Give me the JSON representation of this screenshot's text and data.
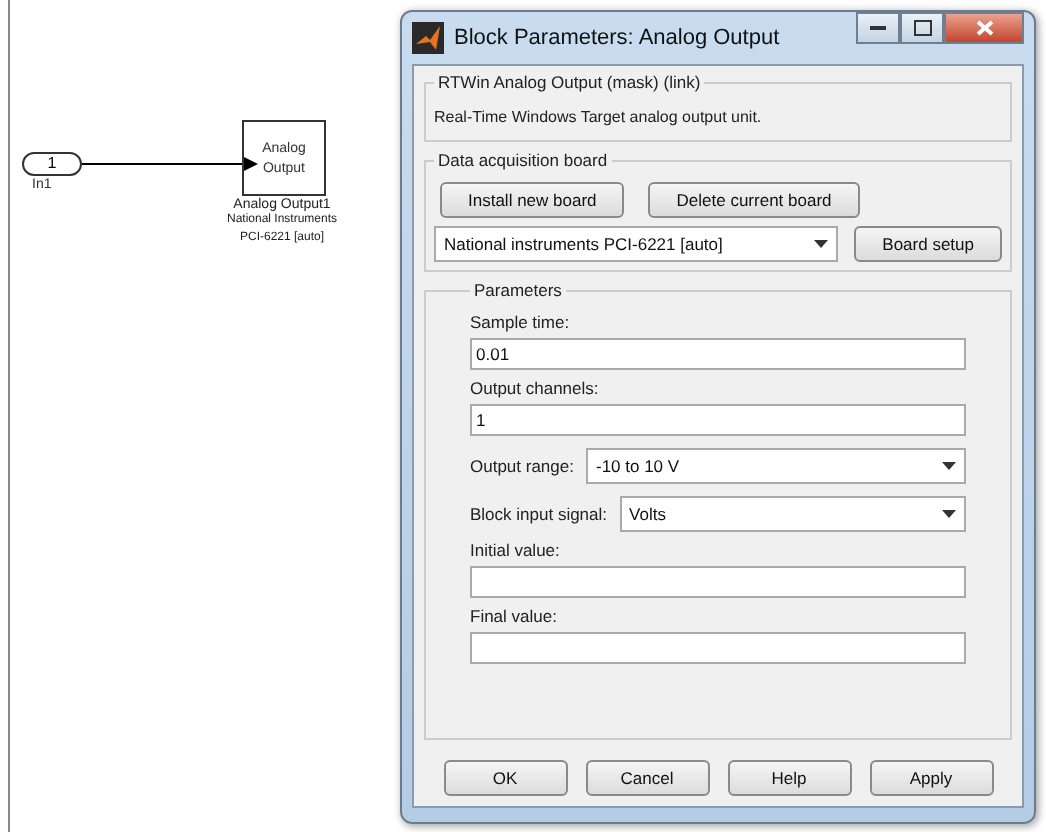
{
  "model": {
    "inport": {
      "number": "1",
      "label": "In1"
    },
    "block": {
      "lines": [
        "Analog",
        "Output"
      ],
      "name": "Analog Output1",
      "sublabels": [
        "National Instruments",
        "PCI-6221 [auto]"
      ]
    }
  },
  "dialog": {
    "title": "Block Parameters: Analog Output",
    "mask": {
      "legend": "RTWin Analog Output (mask) (link)",
      "description": "Real-Time Windows Target analog output unit."
    },
    "board": {
      "legend": "Data acquisition board",
      "buttons": [
        "Install new board",
        "Delete current board"
      ],
      "selected_board": "National instruments PCI-6221 [auto]",
      "setup_button": "Board setup"
    },
    "parameters": {
      "legend": "Parameters",
      "fields": [
        {
          "kind": "text",
          "label": "Sample time:",
          "value": "0.01"
        },
        {
          "kind": "text",
          "label": "Output channels:",
          "value": "1"
        },
        {
          "kind": "select",
          "label": "Output range:",
          "value": "-10 to 10 V"
        },
        {
          "kind": "select",
          "label": "Block input signal:",
          "value": "Volts"
        },
        {
          "kind": "text",
          "label": "Initial value:"
        },
        {
          "kind": "text",
          "label": "Final value:"
        }
      ]
    },
    "buttons": [
      "OK",
      "Cancel",
      "Help",
      "Apply"
    ]
  }
}
